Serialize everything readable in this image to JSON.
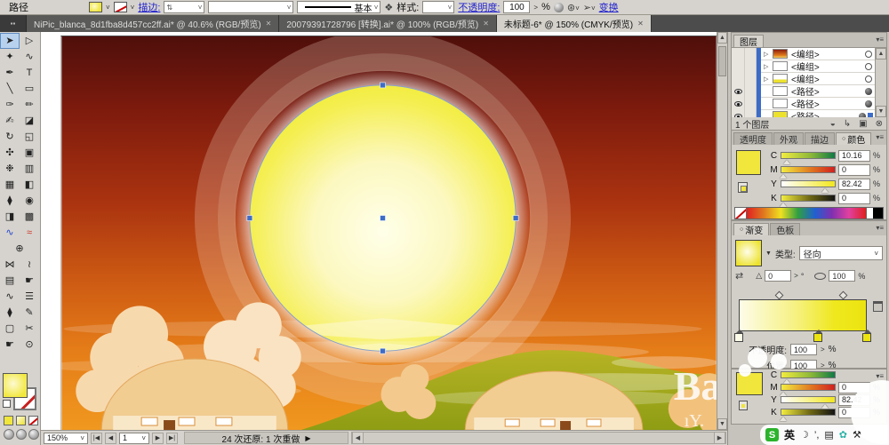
{
  "control_bar": {
    "context_label": "路径",
    "stroke_link": "描边:",
    "brush_name": "基本",
    "style_label": "样式:",
    "opacity_link": "不透明度:",
    "opacity_value": "100",
    "opacity_unit": "%",
    "transform_link": "变换"
  },
  "document_tabs": [
    {
      "title": "NiPic_blanca_8d1fba8d457cc2ff.ai* @ 40.6% (RGB/预览)"
    },
    {
      "title": "20079391728796 [转换].ai* @ 100% (RGB/预览)"
    },
    {
      "title": "未标题-6* @ 150% (CMYK/预览)"
    }
  ],
  "toolbar": {
    "tools": [
      {
        "name": "selection-tool",
        "glyph": "➤",
        "active": true
      },
      {
        "name": "direct-selection-tool",
        "glyph": "▷"
      },
      {
        "name": "magic-wand-tool",
        "glyph": "✦"
      },
      {
        "name": "lasso-tool",
        "glyph": "∿"
      },
      {
        "name": "pen-tool",
        "glyph": "✒"
      },
      {
        "name": "type-tool",
        "glyph": "T"
      },
      {
        "name": "line-tool",
        "glyph": "╲"
      },
      {
        "name": "rectangle-tool",
        "glyph": "▭"
      },
      {
        "name": "paintbrush-tool",
        "glyph": "✑"
      },
      {
        "name": "pencil-tool",
        "glyph": "✏"
      },
      {
        "name": "blob-brush-tool",
        "glyph": "✍"
      },
      {
        "name": "eraser-tool",
        "glyph": "◪"
      },
      {
        "name": "rotate-tool",
        "glyph": "↻"
      },
      {
        "name": "scale-tool",
        "glyph": "◱"
      },
      {
        "name": "warp-tool",
        "glyph": "✣"
      },
      {
        "name": "free-transform-tool",
        "glyph": "▣"
      },
      {
        "name": "symbol-sprayer-tool",
        "glyph": "❉"
      },
      {
        "name": "column-graph-tool",
        "glyph": "▥"
      },
      {
        "name": "mesh-tool",
        "glyph": "▦"
      },
      {
        "name": "gradient-tool",
        "glyph": "◧"
      },
      {
        "name": "eyedropper-tool",
        "glyph": "⧫"
      },
      {
        "name": "blend-tool",
        "glyph": "◉"
      },
      {
        "name": "live-paint-bucket-tool",
        "glyph": "◨"
      },
      {
        "name": "live-paint-selection-tool",
        "glyph": "▩"
      },
      {
        "name": "width-tool",
        "glyph": "∿",
        "color": "#2244cc"
      },
      {
        "name": "wave-tool",
        "glyph": "≈",
        "color": "#cc3322"
      },
      {
        "name": "globe-tool",
        "glyph": "⊕",
        "span": true
      },
      {
        "name": "envelope-tool",
        "glyph": "⋈"
      },
      {
        "name": "banner-tool",
        "glyph": "≀"
      },
      {
        "name": "mesh-grid-tool",
        "glyph": "▤"
      },
      {
        "name": "perspective-tool",
        "glyph": "☛"
      },
      {
        "name": "path-scribble-tool",
        "glyph": "∿"
      },
      {
        "name": "align-tool",
        "glyph": "☰"
      },
      {
        "name": "ink-dropper-tool",
        "glyph": "⧫"
      },
      {
        "name": "measure-tool",
        "glyph": "✎"
      },
      {
        "name": "artboard-tool",
        "glyph": "▢"
      },
      {
        "name": "slice-tool",
        "glyph": "✂"
      },
      {
        "name": "hand-tool",
        "glyph": "☛"
      },
      {
        "name": "zoom-tool",
        "glyph": "⊙"
      }
    ]
  },
  "layers_panel": {
    "title": "图层",
    "rows": [
      {
        "label": "<编组>"
      },
      {
        "label": "<编组>"
      },
      {
        "label": "<编组>"
      },
      {
        "label": "<路径>"
      },
      {
        "label": "<路径>"
      },
      {
        "label": "<路径>"
      }
    ],
    "footer": "1 个图层",
    "footer_icons": [
      {
        "name": "make-clip-mask",
        "glyph": "◒"
      },
      {
        "name": "new-sublayer",
        "glyph": "↳"
      },
      {
        "name": "new-layer",
        "glyph": "▣"
      },
      {
        "name": "delete-layer",
        "glyph": "⊗"
      }
    ]
  },
  "appearance_tabs": {
    "t0": "透明度",
    "t1": "外观",
    "t2": "描边",
    "t3": "颜色"
  },
  "color_panel": {
    "channels": [
      {
        "name": "C",
        "value": "10.16",
        "unit": "%",
        "pos": 10
      },
      {
        "name": "M",
        "value": "0",
        "unit": "%",
        "pos": 3
      },
      {
        "name": "Y",
        "value": "82.42",
        "unit": "%",
        "pos": 82
      },
      {
        "name": "K",
        "value": "0",
        "unit": "%",
        "pos": 3
      }
    ]
  },
  "gradient_panel": {
    "tab_gradient": "渐变",
    "tab_swatches": "色板",
    "type_label": "类型:",
    "type_value": "径向",
    "angle_value": "0",
    "aspect_value": "100",
    "unit": "%",
    "opacity_label": "不透明度:",
    "opacity_value": "100",
    "location_label": "位置:",
    "location_value": "100",
    "stops": [
      0,
      62,
      100
    ],
    "midpoints": [
      31,
      81
    ]
  },
  "floating_color_panel": {
    "channels": [
      {
        "name": "C",
        "value": "",
        "pos": 10
      },
      {
        "name": "M",
        "value": "0",
        "pos": 3
      },
      {
        "name": "Y",
        "value": "82.42",
        "pos": 82
      },
      {
        "name": "K",
        "value": "0",
        "pos": 3
      }
    ],
    "unit": "%"
  },
  "status_bar": {
    "zoom_value": "150%",
    "page_value": "1",
    "history_text": "24 次还原: 1 次重做"
  },
  "taskbar": {
    "ime_label": "英",
    "icons": {
      "sogou": "S",
      "moon": "☽",
      "punct": "’,",
      "keyboard": "▤",
      "flower": "✿",
      "wrench": "⚒"
    }
  },
  "icons": {
    "close": "✕",
    "chevron": "˅",
    "menu": "▾≡",
    "spinner": "⇅",
    "stepper": ">",
    "expand": "▷",
    "dot": "○",
    "first": "|◀",
    "prev": "◀",
    "next": "▶",
    "last": "▶|",
    "up": "▲",
    "down": "▼",
    "play": "▶",
    "degree": "°",
    "reverse": "⇄",
    "angle": "△",
    "style_flower": "❖",
    "recolor": "⊛",
    "select_arrow": "➢",
    "dock_dots": "▪▪"
  },
  "colors": {
    "link_blue": "#2323cc",
    "selection_blue": "#3d6cc8",
    "sun_yellow": "#ece410",
    "fill_yellow": "#f0e63c"
  }
}
